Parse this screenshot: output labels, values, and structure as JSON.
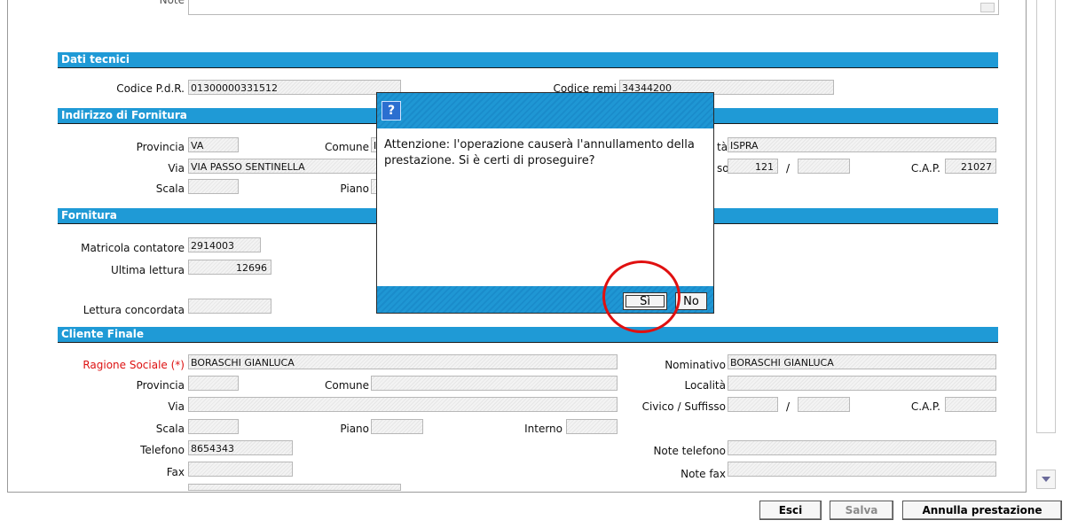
{
  "top": {
    "note_label": "Note"
  },
  "sections": {
    "dati_tecnici": "Dati tecnici",
    "indirizzo": "Indirizzo di Fornitura",
    "fornitura": "Fornitura",
    "cliente": "Cliente Finale"
  },
  "dati_tecnici": {
    "codice_pdr_label": "Codice P.d.R.",
    "codice_pdr": "01300000331512",
    "codice_remi_label": "Codice remi",
    "codice_remi": "34344200"
  },
  "indirizzo": {
    "provincia_label": "Provincia",
    "provincia": "VA",
    "comune_label": "Comune",
    "comune": "IS",
    "localita_label": "Località",
    "localita_visible": "tà",
    "localita": "ISPRA",
    "via_label": "Via",
    "via": "VIA PASSO SENTINELLA",
    "civico_label_visible": "so",
    "civico": "121",
    "suffisso_sep": "/",
    "cap_label": "C.A.P.",
    "cap": "21027",
    "scala_label": "Scala",
    "piano_label": "Piano"
  },
  "fornitura": {
    "matricola_label": "Matricola contatore",
    "matricola": "2914003",
    "ultima_lettura_label": "Ultima lettura",
    "ultima_lettura": "12696",
    "lettura_concordata_label": "Lettura concordata"
  },
  "cliente": {
    "ragione_sociale_label": "Ragione Sociale (*)",
    "ragione_sociale": "BORASCHI GIANLUCA",
    "nominativo_label": "Nominativo",
    "nominativo": "BORASCHI GIANLUCA",
    "provincia_label": "Provincia",
    "comune_label": "Comune",
    "localita_label": "Località",
    "via_label": "Via",
    "civico_label": "Civico / Suffisso",
    "suffisso_sep": "/",
    "cap_label": "C.A.P.",
    "scala_label": "Scala",
    "piano_label": "Piano",
    "interno_label": "Interno",
    "telefono_label": "Telefono",
    "telefono": "8654343",
    "note_telefono_label": "Note telefono",
    "fax_label": "Fax",
    "note_fax_label": "Note fax"
  },
  "dialog": {
    "icon": "question-icon",
    "icon_glyph": "?",
    "message": "Attenzione: l'operazione causerà l'annullamento della prestazione. Si è certi di proseguire?",
    "yes_label": "Sì",
    "no_label": "No"
  },
  "buttons": {
    "esci": "Esci",
    "salva": "Salva",
    "annulla": "Annulla prestazione"
  },
  "colors": {
    "section_bg": "#1f9ad6",
    "required": "#dd1111",
    "highlight_ring": "#e01010"
  }
}
